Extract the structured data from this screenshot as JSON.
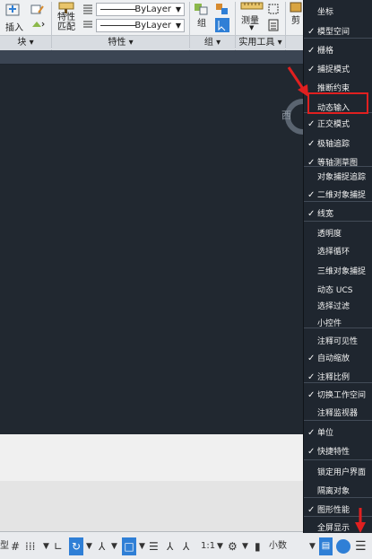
{
  "ribbon": {
    "insert_label": "插入",
    "match_props_label": "特性\n匹配",
    "bylayer_1": "ByLayer",
    "bylayer_2": "ByLayer",
    "group_label": "组",
    "measure_label": "测量",
    "paste_label": "剪",
    "panels": {
      "block": "块 ▾",
      "properties": "特性 ▾",
      "group": "组 ▾",
      "utilities": "实用工具 ▾"
    }
  },
  "viewcube": {
    "west": "西"
  },
  "statusbar": {
    "model_tail": "型",
    "scale": "1:1",
    "units": "小数"
  },
  "menu": {
    "items": [
      {
        "label": "坐标",
        "checked": false
      },
      {
        "label": "模型空间",
        "checked": true
      },
      {
        "label": "栅格",
        "checked": true
      },
      {
        "label": "捕捉模式",
        "checked": true
      },
      {
        "label": "推断约束",
        "checked": false
      },
      {
        "label": "动态输入",
        "checked": false
      },
      {
        "label": "正交模式",
        "checked": true
      },
      {
        "label": "极轴追踪",
        "checked": true
      },
      {
        "label": "等轴测草图",
        "checked": true
      },
      {
        "label": "对象捕捉追踪",
        "checked": false
      },
      {
        "label": "二维对象捕捉",
        "checked": true
      },
      {
        "label": "线宽",
        "checked": true
      },
      {
        "label": "透明度",
        "checked": false
      },
      {
        "label": "选择循环",
        "checked": false
      },
      {
        "label": "三维对象捕捉",
        "checked": false
      },
      {
        "label": "动态 UCS",
        "checked": false
      },
      {
        "label": "选择过滤",
        "checked": false
      },
      {
        "label": "小控件",
        "checked": false
      },
      {
        "label": "注释可见性",
        "checked": false
      },
      {
        "label": "自动缩放",
        "checked": true
      },
      {
        "label": "注释比例",
        "checked": true
      },
      {
        "label": "切换工作空间",
        "checked": true
      },
      {
        "label": "注释监视器",
        "checked": false
      },
      {
        "label": "单位",
        "checked": true
      },
      {
        "label": "快捷特性",
        "checked": true
      },
      {
        "label": "锁定用户界面",
        "checked": false
      },
      {
        "label": "隔离对象",
        "checked": false
      },
      {
        "label": "图形性能",
        "checked": true
      },
      {
        "label": "全屏显示",
        "checked": false
      }
    ]
  },
  "colors": {
    "menu_bg": "#1f262f",
    "canvas_bg": "#212830",
    "highlight": "#e02020",
    "accent_blue": "#2f7fd6"
  }
}
